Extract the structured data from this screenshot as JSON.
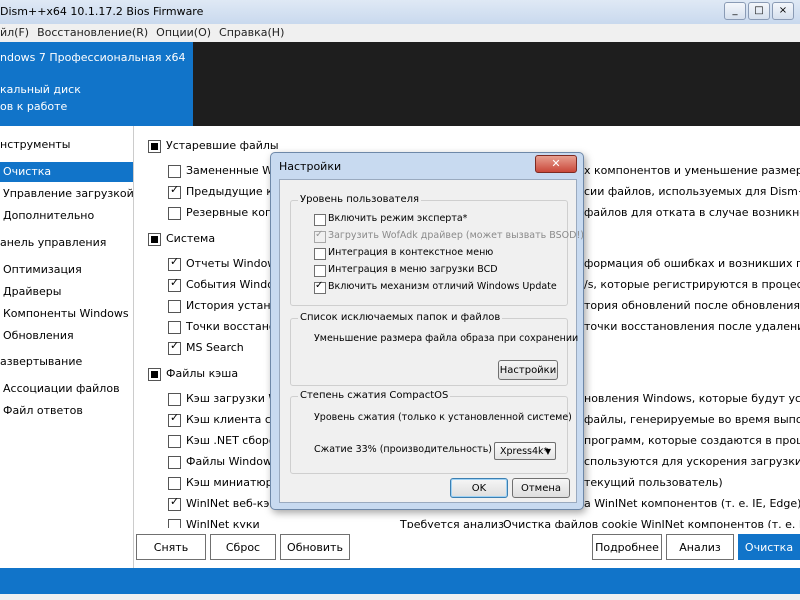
{
  "window": {
    "title": "Dism++x64 10.1.17.2 Bios Firmware",
    "buttons": {
      "minimize": "_",
      "maximize": "□",
      "close": "×"
    }
  },
  "menu": [
    "йл(F)",
    "Восстановление(R)",
    "Опции(O)",
    "Справка(H)"
  ],
  "banner": {
    "os": "ndows 7 Профессиональная x64",
    "disk": "кальный диск",
    "status": "ов к работе"
  },
  "sidebar": {
    "items": [
      {
        "label": "нструменты"
      },
      {
        "label": "Очистка"
      },
      {
        "label": "Управление загрузкой"
      },
      {
        "label": "Дополнительно"
      },
      {
        "label": "анель управления"
      },
      {
        "label": "Оптимизация"
      },
      {
        "label": "Драйверы"
      },
      {
        "label": "Компоненты Windows"
      },
      {
        "label": "Обновления"
      },
      {
        "label": "азвертывание"
      },
      {
        "label": "Ассоциации файлов"
      },
      {
        "label": "Файл ответов"
      }
    ]
  },
  "content": {
    "groups": [
      {
        "label": "Устаревшие файлы"
      },
      {
        "label": "Система"
      },
      {
        "label": "Файлы кэша"
      }
    ],
    "items": [
      {
        "label": "Замененные Win",
        "desc": "х компонентов и уменьшение размера х"
      },
      {
        "label": "Предыдущие ком",
        "desc": "сии файлов, используемых для Dism++."
      },
      {
        "label": "Резервные копи",
        "desc": "файлов для отката в случае возникновения"
      },
      {
        "label": "Отчеты Windows",
        "desc": "формация об ошибках и возникших пробле"
      },
      {
        "label": "События Window",
        "desc": "/s, которые регистрируются в процессе ра"
      },
      {
        "label": "История установ",
        "desc": "тория обновлений после обновления систем"
      },
      {
        "label": "Точки восстанов",
        "desc": "точки восстановления после удаления всех"
      },
      {
        "label": "MS Search",
        "desc": ""
      },
      {
        "label": "Кэш загрузки Win",
        "desc": "новления Windows, которые будут установ"
      },
      {
        "label": "Кэш клиента серв",
        "desc": "файлы, генерируемые во время выполнения"
      },
      {
        "label": "Кэш .NET сборок",
        "desc": "программ, которые создаются в процессе в"
      },
      {
        "label": "Файлы Windows I",
        "desc": "спользуются для ускорения загрузки прилож"
      },
      {
        "label": "Кэш миниатюр (н",
        "desc": "текущий пользователь)"
      },
      {
        "label": "WinINet веб-кэш",
        "desc": "а WinINet компонентов (т. е. IE, Edge) для ка"
      },
      {
        "label": "WinINet куки",
        "status": "Требуется анализ",
        "desc": "Очистка файлов cookie WinINet компонентов (т. е. IE, Edge) для ка"
      }
    ]
  },
  "bottom_buttons": {
    "remove": "Снять",
    "reset": "Сброс",
    "refresh": "Обновить",
    "details": "Подробнее",
    "analyze": "Анализ",
    "clean": "Очистка"
  },
  "dialog": {
    "title": "Настройки",
    "close": "✕",
    "user_level": {
      "title": "Уровень пользователя",
      "options": [
        {
          "label": "Включить режим эксперта*",
          "checked": false
        },
        {
          "label": "Загрузить WofAdk драйвер (может вызвать BSOD!)",
          "checked": true,
          "disabled": true
        },
        {
          "label": "Интеграция в контекстное меню",
          "checked": false
        },
        {
          "label": "Интеграция в меню загрузки BCD",
          "checked": false
        },
        {
          "label": "Включить механизм отличий Windows Update",
          "checked": true
        }
      ]
    },
    "exclusions": {
      "title": "Список исключаемых папок и файлов",
      "text": "Уменьшение размера файла образа при сохранении",
      "button": "Настройки"
    },
    "compactos": {
      "title": "Степень сжатия CompactOS",
      "text": "Уровень сжатия (только к установленной системе)",
      "ratio_label": "Сжатие 33% (производительность)",
      "selected": "Xpress4k*"
    },
    "ok": "OK",
    "cancel": "Отмена"
  }
}
